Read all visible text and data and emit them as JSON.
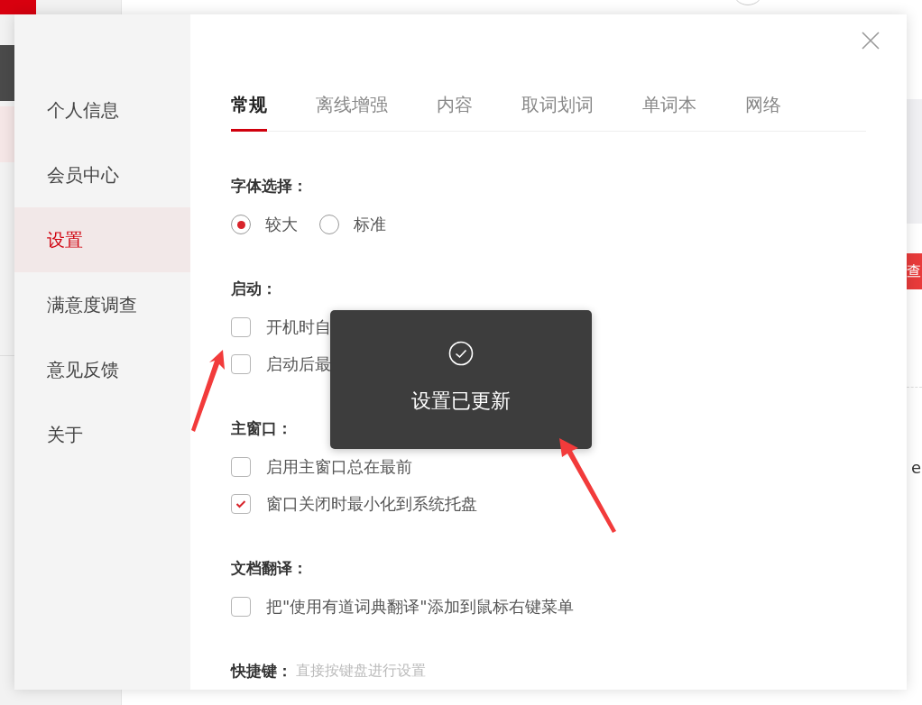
{
  "background": {
    "search_button": "查",
    "text_fragment": "e"
  },
  "dialog": {
    "nav": [
      {
        "label": "个人信息",
        "selected": false
      },
      {
        "label": "会员中心",
        "selected": false
      },
      {
        "label": "设置",
        "selected": true
      },
      {
        "label": "满意度调查",
        "selected": false
      },
      {
        "label": "意见反馈",
        "selected": false
      },
      {
        "label": "关于",
        "selected": false
      }
    ],
    "tabs": [
      {
        "label": "常规",
        "selected": true
      },
      {
        "label": "离线增强",
        "selected": false
      },
      {
        "label": "内容",
        "selected": false
      },
      {
        "label": "取词划词",
        "selected": false
      },
      {
        "label": "单词本",
        "selected": false
      },
      {
        "label": "网络",
        "selected": false
      }
    ],
    "sections": [
      {
        "title": "字体选择：",
        "kind": "radio",
        "options": [
          {
            "label": "较大",
            "selected": true
          },
          {
            "label": "标准",
            "selected": false
          }
        ]
      },
      {
        "title": "启动：",
        "kind": "checkbox",
        "options": [
          {
            "label": "开机时自",
            "checked": false
          },
          {
            "label": "启动后最",
            "checked": false
          }
        ]
      },
      {
        "title": "主窗口：",
        "kind": "checkbox",
        "options": [
          {
            "label": "启用主窗口总在最前",
            "checked": false
          },
          {
            "label": "窗口关闭时最小化到系统托盘",
            "checked": true
          }
        ]
      },
      {
        "title": "文档翻译：",
        "kind": "checkbox",
        "options": [
          {
            "label": "把\"使用有道词典翻译\"添加到鼠标右键菜单",
            "checked": false
          }
        ]
      },
      {
        "title": "快捷键：",
        "kind": "hint",
        "hint": "直接按键盘进行设置"
      }
    ]
  },
  "toast": {
    "message": "设置已更新"
  }
}
